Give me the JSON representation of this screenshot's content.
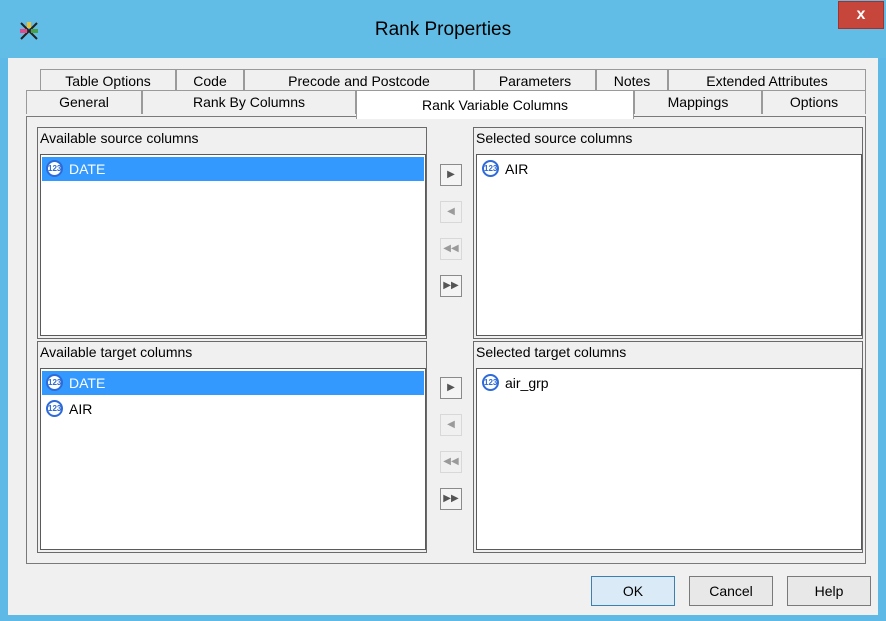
{
  "window": {
    "title": "Rank Properties",
    "close_label": "x"
  },
  "tabs_row1": [
    "Table Options",
    "Code",
    "Precode and Postcode",
    "Parameters",
    "Notes",
    "Extended Attributes"
  ],
  "tabs_row2": [
    "General",
    "Rank By Columns",
    "Rank Variable Columns",
    "Mappings",
    "Options"
  ],
  "active_tab": "Rank Variable Columns",
  "source": {
    "available_label": "Available source columns",
    "available_items": [
      {
        "label": "DATE",
        "icon": "numeric-column-icon",
        "selected": true
      }
    ],
    "selected_label": "Selected source columns",
    "selected_items": [
      {
        "label": "AIR",
        "icon": "numeric-column-icon"
      }
    ]
  },
  "target": {
    "available_label": "Available target columns",
    "available_items": [
      {
        "label": "DATE",
        "icon": "numeric-column-icon",
        "selected": true
      },
      {
        "label": "AIR",
        "icon": "numeric-column-icon"
      }
    ],
    "selected_label": "Selected target columns",
    "selected_items": [
      {
        "label": "air_grp",
        "icon": "numeric-column-icon"
      }
    ]
  },
  "icon_glyph": "123",
  "arrows": {
    "add": "▶",
    "remove": "◀",
    "remove_all": "◀◀",
    "add_all": "▶▶"
  },
  "buttons": {
    "ok": "OK",
    "cancel": "Cancel",
    "help": "Help"
  },
  "colors": {
    "titlebar": "#62bde6",
    "selection": "#3399ff",
    "close": "#c7463c"
  }
}
